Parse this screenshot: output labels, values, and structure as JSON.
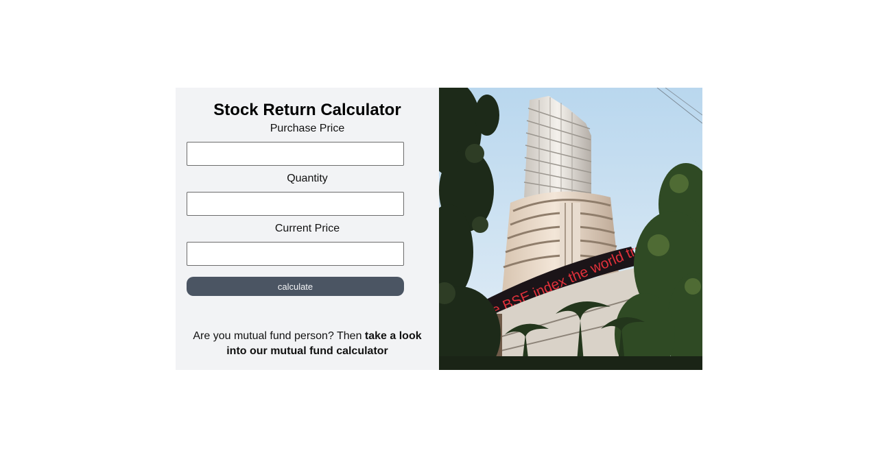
{
  "calculator": {
    "title": "Stock Return Calculator",
    "purchase_price_label": "Purchase Price",
    "purchase_price_value": "",
    "quantity_label": "Quantity",
    "quantity_value": "",
    "current_price_label": "Current Price",
    "current_price_value": "",
    "calculate_label": "calculate"
  },
  "promo": {
    "text": "Are you mutual fund person? Then ",
    "link_text": "take a look into our mutual fund calculator"
  },
  "photo": {
    "ticker_text": "The BSE index the world tracks."
  },
  "colors": {
    "panel_bg": "#f2f3f5",
    "button_bg": "#4b5563",
    "ticker": "#e0303a"
  }
}
